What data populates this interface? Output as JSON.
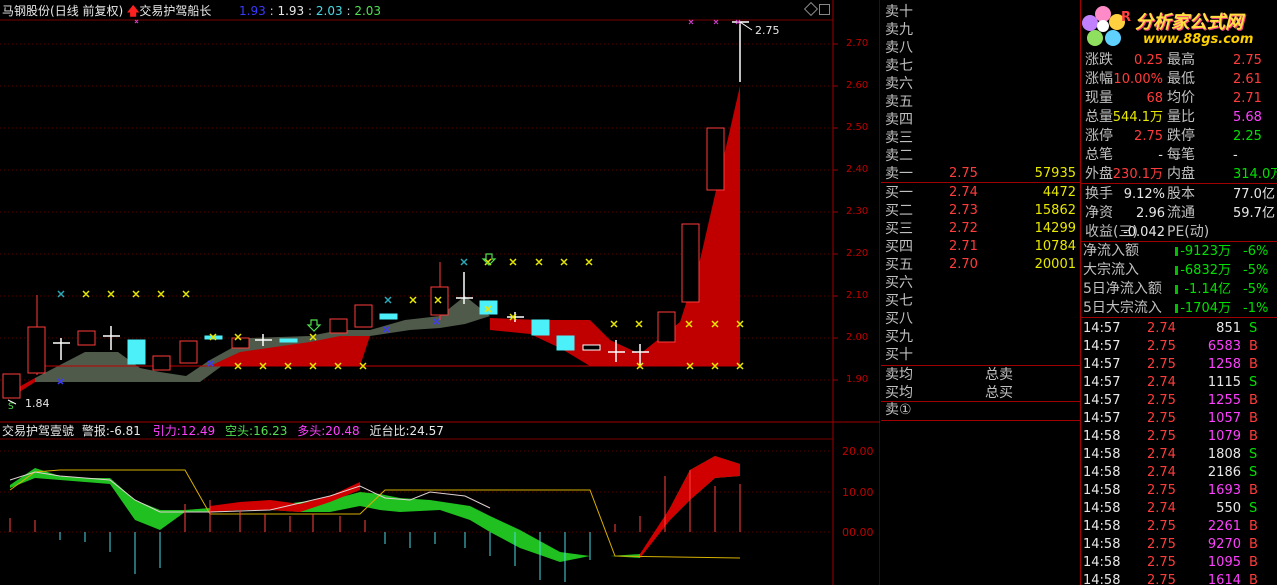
{
  "header": {
    "stock_name": "马钢股份",
    "period": "(日线 前复权)",
    "indicator": "交易护驾船长",
    "v1": "1.93",
    "v2": "1.93",
    "v3": "2.03",
    "v4": "2.03"
  },
  "price_axis": [
    "2.70",
    "2.60",
    "2.50",
    "2.40",
    "2.30",
    "2.20",
    "2.10",
    "2.00",
    "1.90"
  ],
  "price_marks": {
    "high": "2.75",
    "low": "1.84"
  },
  "sub": {
    "title": "交易护驾壹號",
    "warn_label": "警报:",
    "warn_value": "-6.81",
    "pull_label": "引力:",
    "pull_value": "12.49",
    "short_label": "空头:",
    "short_value": "16.23",
    "long_label": "多头:",
    "long_value": "20.48",
    "near_label": "近台比:",
    "near_value": "24.57",
    "axis": [
      "20.00",
      "10.00",
      "00.00"
    ]
  },
  "orderbook": {
    "sell": [
      {
        "label": "卖十",
        "price": "",
        "vol": ""
      },
      {
        "label": "卖九",
        "price": "",
        "vol": ""
      },
      {
        "label": "卖八",
        "price": "",
        "vol": ""
      },
      {
        "label": "卖七",
        "price": "",
        "vol": ""
      },
      {
        "label": "卖六",
        "price": "",
        "vol": ""
      },
      {
        "label": "卖五",
        "price": "",
        "vol": ""
      },
      {
        "label": "卖四",
        "price": "",
        "vol": ""
      },
      {
        "label": "卖三",
        "price": "",
        "vol": ""
      },
      {
        "label": "卖二",
        "price": "",
        "vol": ""
      },
      {
        "label": "卖一",
        "price": "2.75",
        "vol": "57935"
      }
    ],
    "buy": [
      {
        "label": "买一",
        "price": "2.74",
        "vol": "4472"
      },
      {
        "label": "买二",
        "price": "2.73",
        "vol": "15862"
      },
      {
        "label": "买三",
        "price": "2.72",
        "vol": "14299"
      },
      {
        "label": "买四",
        "price": "2.71",
        "vol": "10784"
      },
      {
        "label": "买五",
        "price": "2.70",
        "vol": "20001"
      },
      {
        "label": "买六",
        "price": "",
        "vol": ""
      },
      {
        "label": "买七",
        "price": "",
        "vol": ""
      },
      {
        "label": "买八",
        "price": "",
        "vol": ""
      },
      {
        "label": "买九",
        "price": "",
        "vol": ""
      },
      {
        "label": "买十",
        "price": "",
        "vol": ""
      }
    ],
    "sell_avg": "卖均",
    "buy_avg": "买均",
    "total_sell": "总卖",
    "total_buy": "总买",
    "sell_one": "卖①"
  },
  "logo": {
    "text": "分析家公式网",
    "url": "www.88gs.com",
    "mark": "R"
  },
  "quote": [
    [
      "涨跌",
      "0.25",
      "red",
      "最高",
      "2.75",
      "red"
    ],
    [
      "涨幅",
      "10.00%",
      "red",
      "最低",
      "2.61",
      "red"
    ],
    [
      "现量",
      "68",
      "red",
      "均价",
      "2.71",
      "red"
    ],
    [
      "总量",
      "544.1万",
      "yellow",
      "量比",
      "5.68",
      "mag"
    ],
    [
      "涨停",
      "2.75",
      "red",
      "跌停",
      "2.25",
      "green"
    ],
    [
      "总笔",
      "-",
      "white",
      "每笔",
      "-",
      "white"
    ],
    [
      "外盘",
      "230.1万",
      "red",
      "内盘",
      "314.0万",
      "green"
    ]
  ],
  "fund": [
    [
      "换手",
      "9.12%",
      "股本",
      "77.0亿"
    ],
    [
      "净资",
      "2.96",
      "流通",
      "59.7亿"
    ],
    [
      "收益(三)",
      "-0.042",
      "PE(动)",
      ""
    ]
  ],
  "flow": [
    [
      "净流入额",
      "-9123万",
      "-6%"
    ],
    [
      "大宗流入",
      "-6832万",
      "-5%"
    ],
    [
      "5日净流入额",
      "-1.14亿",
      "-5%"
    ],
    [
      "5日大宗流入",
      "-1704万",
      "-1%"
    ]
  ],
  "ticks": [
    [
      "14:57",
      "2.74",
      "851",
      "S"
    ],
    [
      "14:57",
      "2.75",
      "6583",
      "B"
    ],
    [
      "14:57",
      "2.75",
      "1258",
      "B"
    ],
    [
      "14:57",
      "2.74",
      "1115",
      "S"
    ],
    [
      "14:57",
      "2.75",
      "1255",
      "B"
    ],
    [
      "14:57",
      "2.75",
      "1057",
      "B"
    ],
    [
      "14:58",
      "2.75",
      "1079",
      "B"
    ],
    [
      "14:58",
      "2.74",
      "1808",
      "S"
    ],
    [
      "14:58",
      "2.74",
      "2186",
      "S"
    ],
    [
      "14:58",
      "2.75",
      "1693",
      "B"
    ],
    [
      "14:58",
      "2.74",
      "550",
      "S"
    ],
    [
      "14:58",
      "2.75",
      "2261",
      "B"
    ],
    [
      "14:58",
      "2.75",
      "9270",
      "B"
    ],
    [
      "14:58",
      "2.75",
      "1095",
      "B"
    ],
    [
      "14:58",
      "2.75",
      "1614",
      "B"
    ]
  ]
}
